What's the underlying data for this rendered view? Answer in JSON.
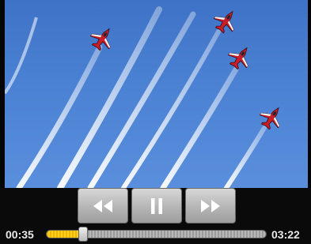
{
  "player": {
    "current_time": "00:35",
    "total_time": "03:22",
    "progress": 0.17,
    "state": "playing"
  },
  "controls": {
    "rewind_icon": "rewind-icon",
    "pause_icon": "pause-icon",
    "fast_forward_icon": "fast-forward-icon"
  },
  "colors": {
    "sky": "#4a80d2",
    "progress_fill": "#f9c010",
    "jet_red": "#c0202a"
  }
}
